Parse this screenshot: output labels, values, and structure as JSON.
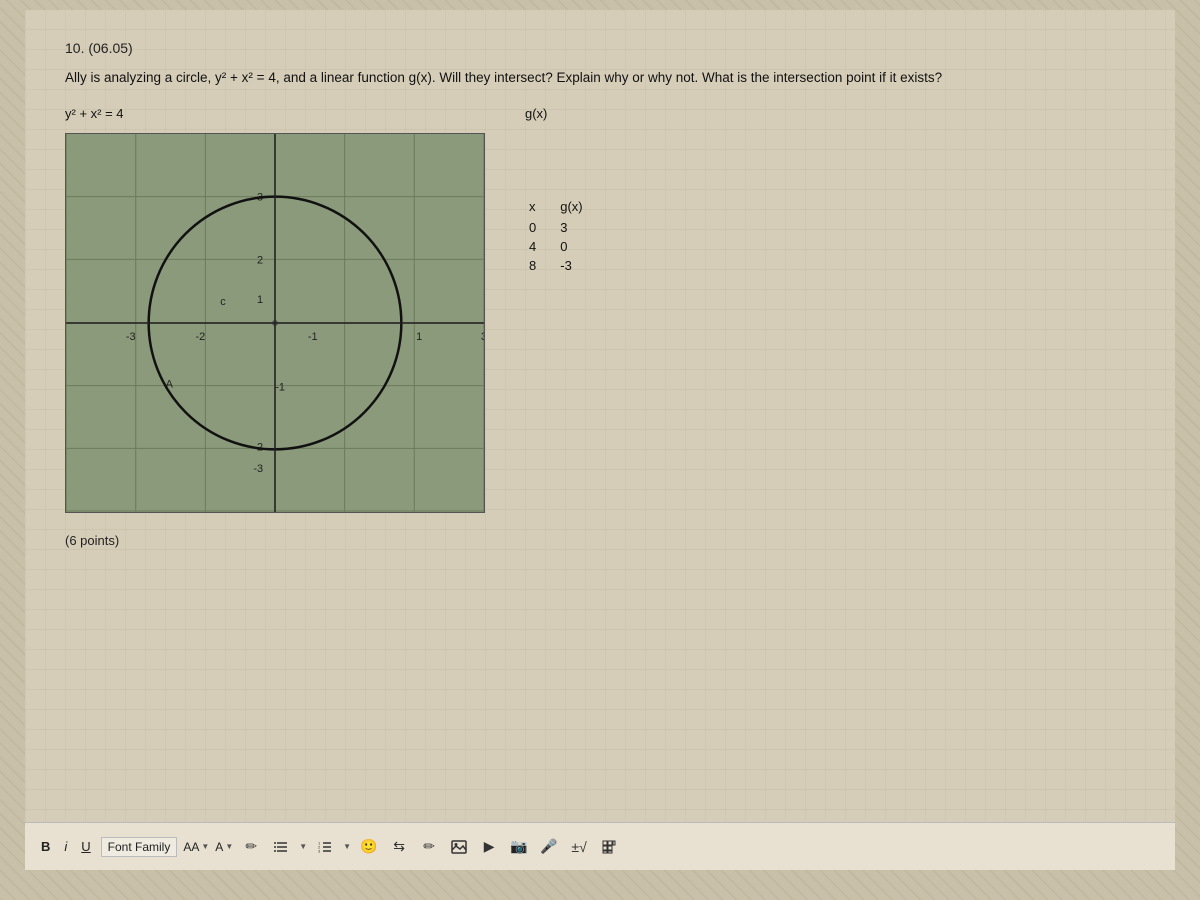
{
  "problem": {
    "number": "10. (06.05)",
    "text": "Ally is analyzing a circle, y² + x² = 4, and a linear function g(x). Will they intersect? Explain why or why not. What is the intersection point if it exists?",
    "circle_equation": "y² + x² = 4",
    "gx_label": "g(x)",
    "table": {
      "headers": [
        "x",
        "g(x)"
      ],
      "rows": [
        [
          "0",
          "3"
        ],
        [
          "4",
          "0"
        ],
        [
          "8",
          "-3"
        ]
      ]
    },
    "points_label": "(6 points)"
  },
  "toolbar": {
    "bold_label": "B",
    "italic_label": "i",
    "underline_label": "U",
    "font_family_label": "Font Family",
    "aa_label": "AA",
    "a_label": "A"
  }
}
